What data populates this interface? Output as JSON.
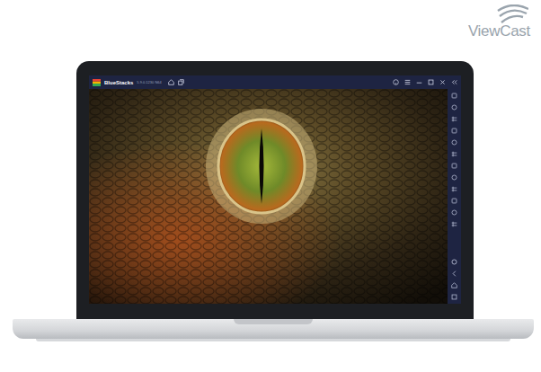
{
  "brand": {
    "name": "ViewCast"
  },
  "window": {
    "title": "BlueStacks",
    "version": "5.9.0.1230 N64"
  }
}
